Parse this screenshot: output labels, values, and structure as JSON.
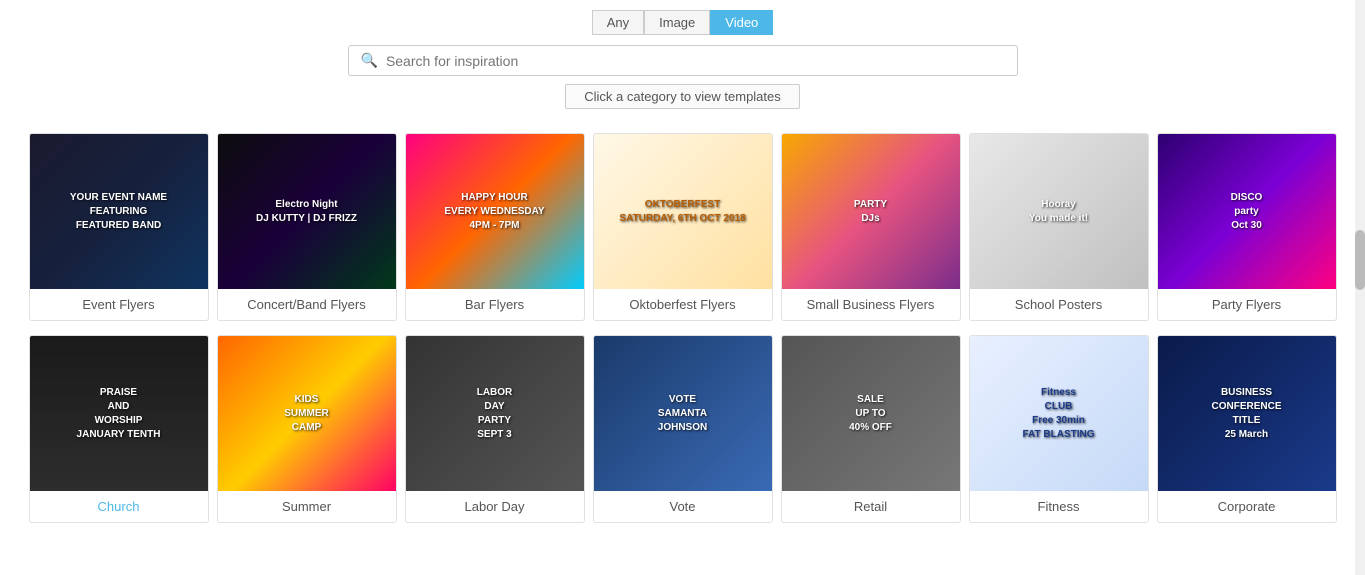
{
  "header": {
    "filter_any_label": "Any",
    "filter_image_label": "Image",
    "filter_video_label": "Video",
    "search_placeholder": "Search for inspiration",
    "category_hint": "Click a category to view templates"
  },
  "rows": [
    {
      "id": "row1",
      "cards": [
        {
          "id": "event-flyers",
          "label": "Event Flyers",
          "highlight": false,
          "bg_class": "event-bg",
          "img_text": "YOUR EVENT NAME\nFEATURING\nFEATURED BAND"
        },
        {
          "id": "concert-band-flyers",
          "label": "Concert/Band Flyers",
          "highlight": false,
          "bg_class": "concert-bg",
          "img_text": "Electro Night\nDJ KUTTY | DJ FRIZZ"
        },
        {
          "id": "bar-flyers",
          "label": "Bar Flyers",
          "highlight": false,
          "bg_class": "bar-bg",
          "img_text": "HAPPY HOUR\nEVERY WEDNESDAY\n4PM - 7PM"
        },
        {
          "id": "oktoberfest-flyers",
          "label": "Oktoberfest Flyers",
          "highlight": false,
          "bg_class": "okto-bg",
          "img_text": "OKTOBERFEST\nSATURDAY, 6TH OCT 2018"
        },
        {
          "id": "small-business-flyers",
          "label": "Small Business Flyers",
          "highlight": false,
          "bg_class": "smallbiz-bg",
          "img_text": "PARTY\nDJs"
        },
        {
          "id": "school-posters",
          "label": "School Posters",
          "highlight": false,
          "bg_class": "school-bg",
          "img_text": "Hooray\nYou made it!"
        },
        {
          "id": "party-flyers",
          "label": "Party Flyers",
          "highlight": false,
          "bg_class": "party-bg",
          "img_text": "DISCO\nparty\nOct 30"
        }
      ]
    },
    {
      "id": "row2",
      "cards": [
        {
          "id": "church",
          "label": "Church",
          "highlight": true,
          "bg_class": "church-bg",
          "img_text": "PRAISE\nAND\nWORSHIP\nJANUARY TENTH"
        },
        {
          "id": "summer",
          "label": "Summer",
          "highlight": false,
          "bg_class": "summer-bg",
          "img_text": "KIDS\nSUMMER\nCAMP"
        },
        {
          "id": "labor-day",
          "label": "Labor Day",
          "highlight": false,
          "bg_class": "laborday-bg",
          "img_text": "LABOR\nDAY\nPARTY\nSEPT 3"
        },
        {
          "id": "vote",
          "label": "Vote",
          "highlight": false,
          "bg_class": "vote-bg",
          "img_text": "VOTE\nSAMANTA\nJOHNSON"
        },
        {
          "id": "retail",
          "label": "Retail",
          "highlight": false,
          "bg_class": "retail-bg",
          "img_text": "SALE\nUP TO\n40% OFF"
        },
        {
          "id": "fitness",
          "label": "Fitness",
          "highlight": false,
          "bg_class": "fitness-bg",
          "img_text": "Fitness\nCLUB\nFree 30min\nFAT BLASTING"
        },
        {
          "id": "corporate",
          "label": "Corporate",
          "highlight": false,
          "bg_class": "corporate-bg",
          "img_text": "BUSINESS\nCONFERENCE\nTITLE\n25 March"
        }
      ]
    }
  ]
}
